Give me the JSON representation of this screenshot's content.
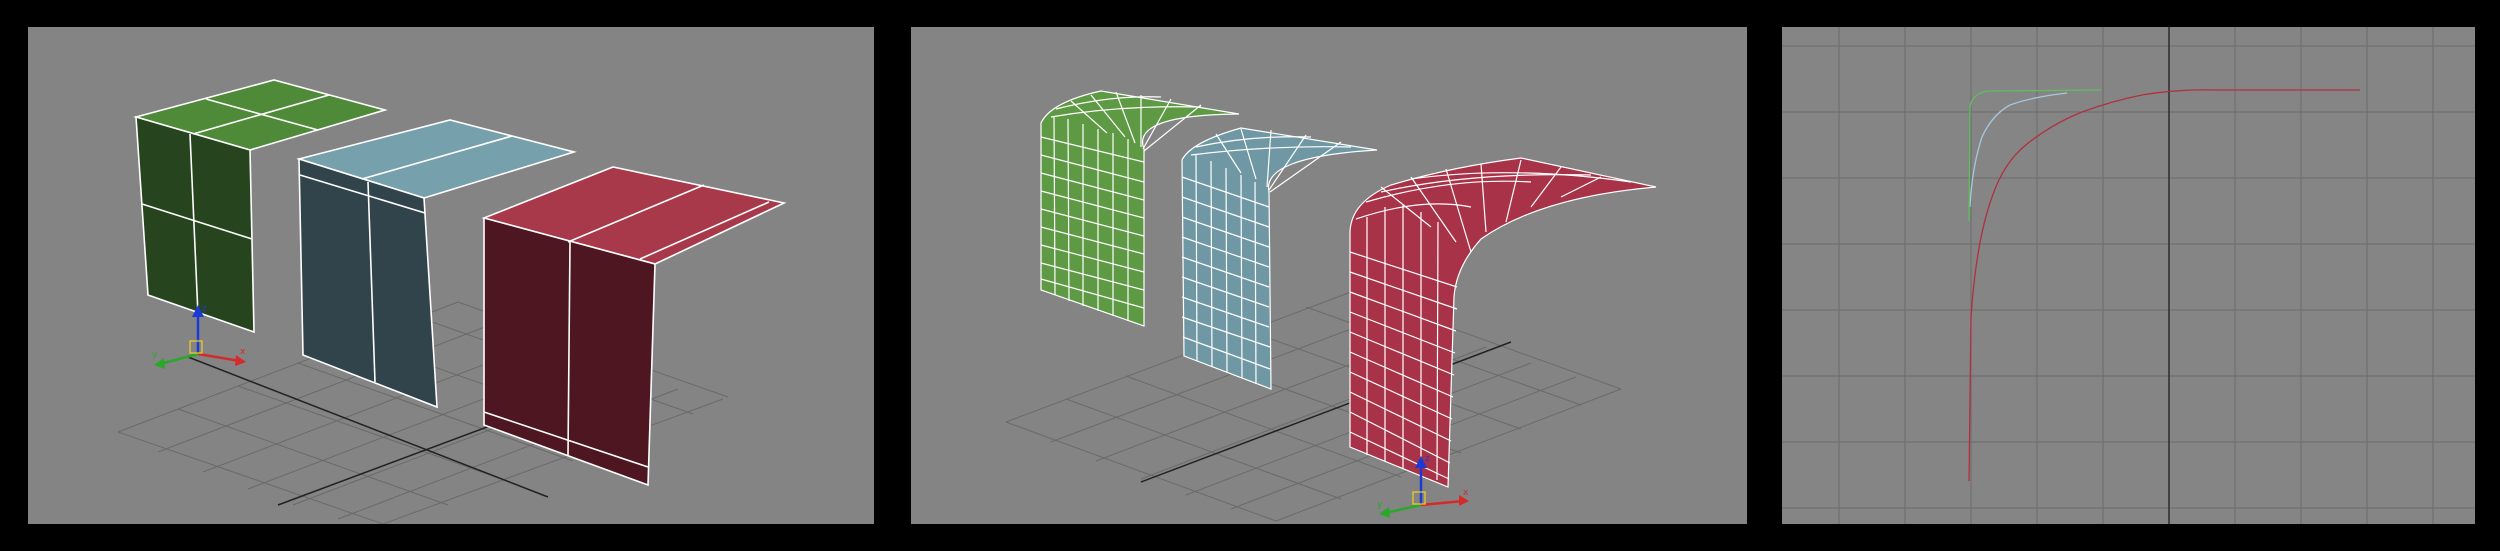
{
  "screen": {
    "background": "#000000",
    "viewport_background": "#848484"
  },
  "viewports": [
    {
      "id": "left",
      "content": "three-flat-bent-panels",
      "panels": [
        {
          "name": "green",
          "color": "#4f8a38",
          "front_color": "#26441d"
        },
        {
          "name": "blue",
          "color": "#76a0ac",
          "front_color": "#31434b"
        },
        {
          "name": "red",
          "color": "#a8394a",
          "front_color": "#4e1620"
        }
      ],
      "gizmo": {
        "axes": [
          "x",
          "y",
          "z"
        ],
        "x_color": "#d42a2a",
        "y_color": "#2aa82a",
        "z_color": "#1e3ad6"
      }
    },
    {
      "id": "middle",
      "content": "three-curved-subdivided-panels",
      "panels": [
        {
          "name": "green",
          "color": "#5e9a44"
        },
        {
          "name": "blue",
          "color": "#6f98a4"
        },
        {
          "name": "red",
          "color": "#a83247"
        }
      ],
      "gizmo": {
        "axes": [
          "x",
          "y",
          "z"
        ],
        "x_color": "#d42a2a",
        "y_color": "#2aa82a",
        "z_color": "#1e3ad6"
      }
    },
    {
      "id": "right",
      "content": "curve-editor-graph",
      "grid": true,
      "curves": [
        {
          "name": "green",
          "color": "#5fbf5f"
        },
        {
          "name": "blue",
          "color": "#a9c7dd"
        },
        {
          "name": "red",
          "color": "#b03040"
        }
      ]
    }
  ]
}
